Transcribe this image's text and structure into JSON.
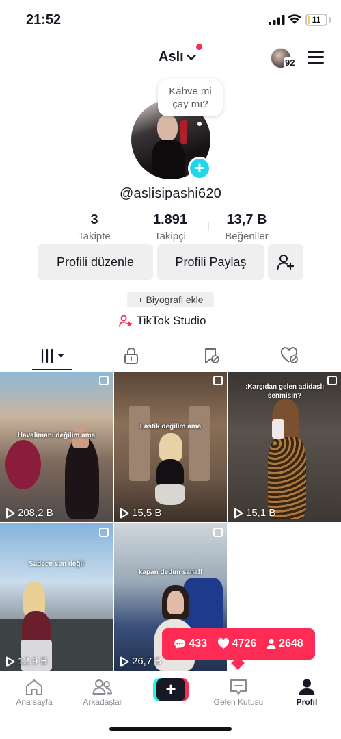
{
  "status_bar": {
    "time": "21:52",
    "battery": "11",
    "battery_level": 0.11
  },
  "header": {
    "account_name": "Aslı",
    "story_count": "92"
  },
  "profile": {
    "bubble_text_line1": "Kahve mi",
    "bubble_text_line2": "çay mı?",
    "username": "@aslisipashi620"
  },
  "stats": [
    {
      "value": "3",
      "label": "Takipte"
    },
    {
      "value": "1.891",
      "label": "Takipçi"
    },
    {
      "value": "13,7 B",
      "label": "Beğeniler"
    }
  ],
  "actions": {
    "edit_profile": "Profili düzenle",
    "share_profile": "Profili Paylaş"
  },
  "bio_chip": "+ Biyografi ekle",
  "studio": "TikTok Studio",
  "videos": [
    {
      "caption": "Havalimanı değilim ama",
      "views": "208,2 B"
    },
    {
      "caption": "Lastik değilim ama",
      "views": "15,5 B"
    },
    {
      "caption": ":Karşıdan gelen adidaslı senmisin?",
      "views": "15,1 B"
    },
    {
      "caption": "Sadece sen değil",
      "views": "12,9 B"
    },
    {
      "caption": "kapan dedim sana!!",
      "views": "26,7 B"
    }
  ],
  "popup": {
    "comments": "433",
    "likes": "4726",
    "followers": "2648"
  },
  "nav": {
    "home": "Ana sayfa",
    "friends": "Arkadaşlar",
    "inbox": "Gelen Kutusu",
    "profile": "Profil"
  },
  "colors": {
    "accent": "#fe2c55",
    "cyan": "#25f4ee",
    "add_button": "#20d5ec",
    "text": "#161823"
  }
}
